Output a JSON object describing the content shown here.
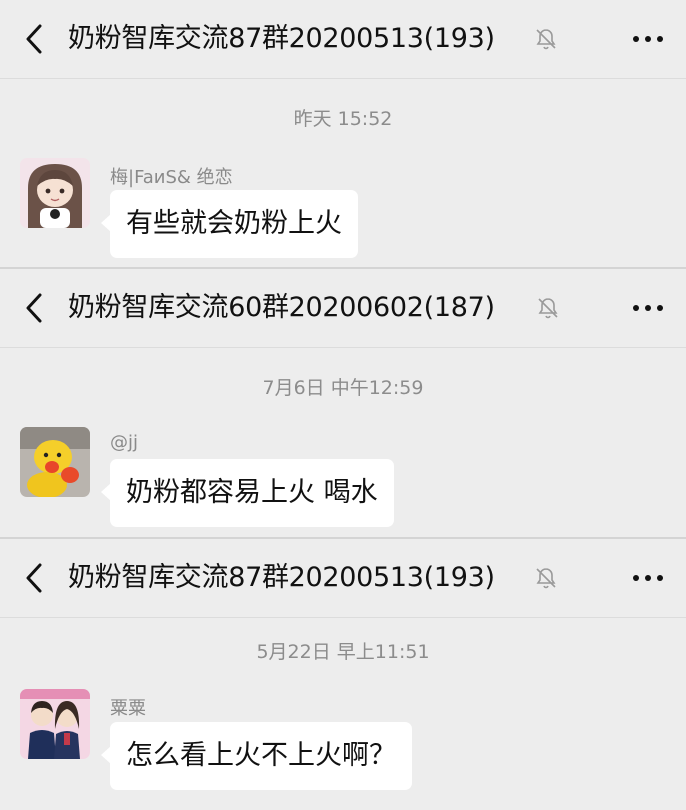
{
  "panels": [
    {
      "header": {
        "title": "奶粉智库交流87群20200513(193)",
        "back_icon": "chevron-left-icon",
        "mute_icon": "bell-off-icon",
        "more_icon": "more-dots-icon"
      },
      "timestamp": "昨天 15:52",
      "message": {
        "sender": "梅|FaиS& 绝恋",
        "text": "有些就会奶粉上火",
        "avatar": "girl-avatar"
      }
    },
    {
      "header": {
        "title": "奶粉智库交流60群20200602(187)",
        "back_icon": "chevron-left-icon",
        "mute_icon": "bell-off-icon",
        "more_icon": "more-dots-icon"
      },
      "timestamp": "7月6日 中午12:59",
      "message": {
        "sender": "@jj",
        "text": "奶粉都容易上火  喝水",
        "avatar": "yellow-duck-avatar"
      }
    },
    {
      "header": {
        "title": "奶粉智库交流87群20200513(193)",
        "back_icon": "chevron-left-icon",
        "mute_icon": "bell-off-icon",
        "more_icon": "more-dots-icon"
      },
      "timestamp": "5月22日 早上11:51",
      "message": {
        "sender": "粟粟",
        "text": "怎么看上火不上火啊？",
        "avatar": "couple-avatar"
      }
    }
  ],
  "colors": {
    "background": "#ededed",
    "bubble": "#ffffff",
    "timestamp": "#8c8c8c",
    "sender": "#8a8a8a"
  }
}
